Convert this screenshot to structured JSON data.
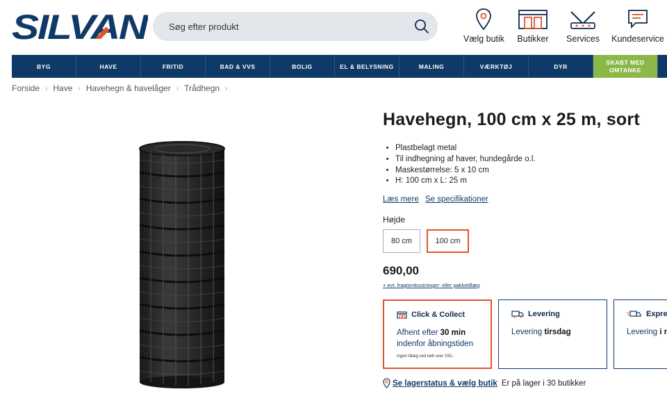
{
  "brand": {
    "logo_text": "SILVAN",
    "primary_color": "#0f3a68",
    "accent_color": "#e0542c",
    "green_color": "#8cb84a"
  },
  "search": {
    "placeholder": "Søg efter produkt"
  },
  "header_links": [
    {
      "label": "Vælg butik",
      "icon": "location-pin-icon"
    },
    {
      "label": "Butikker",
      "icon": "store-icon"
    },
    {
      "label": "Services",
      "icon": "tools-icon"
    },
    {
      "label": "Kundeservice",
      "icon": "chat-icon"
    }
  ],
  "nav": [
    {
      "label": "BYG"
    },
    {
      "label": "HAVE"
    },
    {
      "label": "FRITID"
    },
    {
      "label": "BAD & VVS"
    },
    {
      "label": "BOLIG"
    },
    {
      "label": "EL & BELYSNING"
    },
    {
      "label": "MALING"
    },
    {
      "label": "VÆRKTØJ"
    },
    {
      "label": "DYR"
    },
    {
      "label": "SKABT MED OMTANKE"
    }
  ],
  "breadcrumb": [
    "Forside",
    "Have",
    "Havehegn & havelåger",
    "Trådhegn"
  ],
  "product": {
    "title": "Havehegn, 100 cm x 25 m, sort",
    "bullets": [
      "Plastbelagt metal",
      "Til indhegning af haver, hundegårde o.l.",
      "Maskestørrelse: 5 x 10 cm",
      "H: 100 cm x L: 25 m"
    ],
    "read_more": "Læs mere",
    "specs_link": "Se specifikationer",
    "option_label": "Højde",
    "options": [
      {
        "label": "80 cm",
        "selected": false
      },
      {
        "label": "100 cm",
        "selected": true
      }
    ],
    "price": "690,00",
    "price_note": "+ evt. fragtomkostninger- eller pakketillæg"
  },
  "delivery": [
    {
      "title": "Click & Collect",
      "line1_pre": "Afhent efter ",
      "line1_bold": "30 min",
      "line2": "indenfor åbningstiden",
      "small": "Ingen tillæg ved køb over 150,-",
      "selected": true
    },
    {
      "title": "Levering",
      "line1_pre": "Levering ",
      "line1_bold": "tirsdag",
      "selected": false
    },
    {
      "title": "Expre",
      "line1_pre": "Levering ",
      "line1_bold": "i m",
      "selected": false
    }
  ],
  "stock": {
    "link": "Se lagerstatus & vælg butik",
    "text": "Er på lager i 30 butikker"
  }
}
